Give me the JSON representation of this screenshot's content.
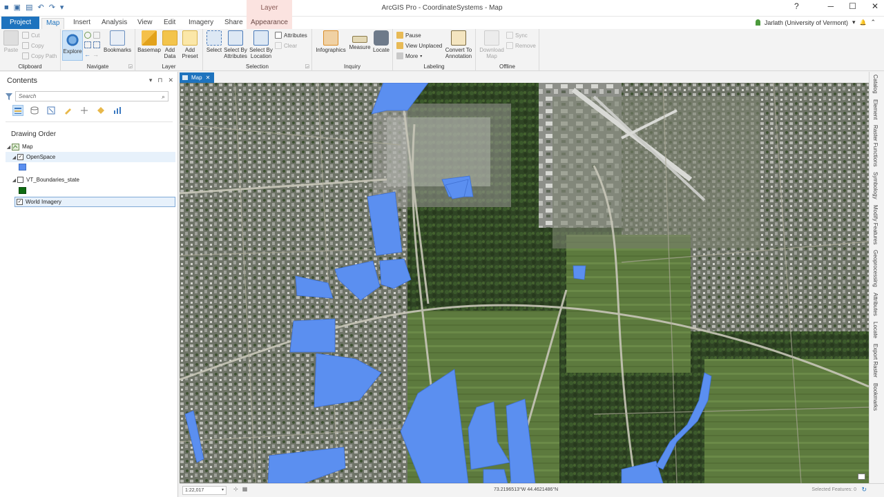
{
  "titlebar": {
    "app_title": "ArcGIS Pro - CoordinateSystems - Map",
    "context_tab_group": "Layer",
    "help": "?",
    "minimize": "─",
    "maximize": "☐",
    "close": "✕"
  },
  "qat": [
    "■",
    "▣",
    "▤",
    "↶",
    "↷",
    "▾"
  ],
  "tabs": {
    "project": "Project",
    "map": "Map",
    "insert": "Insert",
    "analysis": "Analysis",
    "view": "View",
    "edit": "Edit",
    "imagery": "Imagery",
    "share": "Share",
    "appearance": "Appearance"
  },
  "user": {
    "name": "Jarlath (University of Vermont)",
    "dropdown": "▾",
    "bell": "🔔",
    "collapse": "⌃"
  },
  "ribbon": {
    "clipboard": {
      "label": "Clipboard",
      "paste": "Paste",
      "cut": "Cut",
      "copy": "Copy",
      "copy_path": "Copy Path"
    },
    "navigate": {
      "label": "Navigate",
      "explore": "Explore",
      "bookmarks": "Bookmarks"
    },
    "layer": {
      "label": "Layer",
      "basemap": "Basemap",
      "add_data": "Add Data",
      "add_preset": "Add Preset"
    },
    "selection": {
      "label": "Selection",
      "select": "Select",
      "select_by_attributes": "Select By Attributes",
      "select_by_location": "Select By Location",
      "attributes": "Attributes",
      "clear": "Clear"
    },
    "inquiry": {
      "label": "Inquiry",
      "infographics": "Infographics",
      "measure": "Measure",
      "locate": "Locate"
    },
    "labeling": {
      "label": "Labeling",
      "pause": "Pause",
      "view_unplaced": "View Unplaced",
      "more": "More",
      "convert_to_annotation": "Convert To Annotation"
    },
    "offline": {
      "label": "Offline",
      "download_map": "Download Map",
      "sync": "Sync",
      "remove": "Remove"
    }
  },
  "contents": {
    "title": "Contents",
    "pin": "▾",
    "autohide": "⊓",
    "close": "✕",
    "search_placeholder": "Search",
    "section": "Drawing Order",
    "layers": {
      "map": "Map",
      "openspace": "OpenSpace",
      "vt_boundaries": "VT_Boundaries_state",
      "world_imagery": "World Imagery"
    }
  },
  "map_tab": {
    "label": "Map",
    "close": "✕"
  },
  "status": {
    "scale": "1:22,017",
    "coords": "73.2196513°W 44.4621486°N",
    "selected_features": "Selected Features: 0"
  },
  "side_tabs": [
    "Catalog",
    "Element",
    "Raster Functions",
    "Symbology",
    "Modify Features",
    "Geoprocessing",
    "Attributes",
    "Locate",
    "Export Raster",
    "Bookmarks"
  ],
  "colors": {
    "accent": "#1e73be",
    "openspace_fill": "#5b8ff0",
    "boundary_fill": "#0f6b12"
  }
}
